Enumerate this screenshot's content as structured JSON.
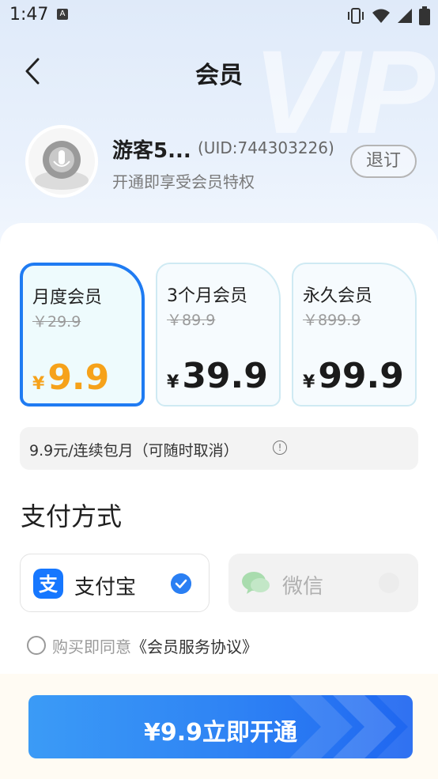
{
  "status_bar": {
    "time": "1:47",
    "notif_glyph": "A",
    "icons": [
      "vibrate-icon",
      "wifi-icon",
      "signal-icon",
      "battery-icon"
    ]
  },
  "header": {
    "title": "会员",
    "back_icon": "chevron-left-icon",
    "watermark": "VIP"
  },
  "user": {
    "name": "游客5...",
    "uid": "(UID:744303226)",
    "subtitle": "开通即享受会员特权",
    "unsubscribe_label": "退订",
    "avatar_icon": "microphone-avatar-icon"
  },
  "plans": [
    {
      "name": "月度会员",
      "original_price": "￥29.9",
      "currency": "¥",
      "price": "9.9",
      "selected": true
    },
    {
      "name": "3个月会员",
      "original_price": "￥89.9",
      "currency": "¥",
      "price": "39.9",
      "selected": false
    },
    {
      "name": "永久会员",
      "original_price": "￥899.9",
      "currency": "¥",
      "price": "99.9",
      "selected": false
    }
  ],
  "note": {
    "text": "9.9元/连续包月（可随时取消）",
    "icon": "info-icon"
  },
  "payment": {
    "title": "支付方式",
    "options": [
      {
        "label": "支付宝",
        "icon": "alipay-icon",
        "selected": true
      },
      {
        "label": "微信",
        "icon": "wechat-icon",
        "selected": false
      }
    ]
  },
  "agreement": {
    "prefix": "购买即同意",
    "link": "《会员服务协议》",
    "checked": false
  },
  "cta": {
    "label": "¥9.9立即开通"
  },
  "colors": {
    "accent": "#1f7bf2",
    "price_highlight": "#f6a21a",
    "alipay": "#1677ff",
    "wechat": "#5ec26a"
  }
}
